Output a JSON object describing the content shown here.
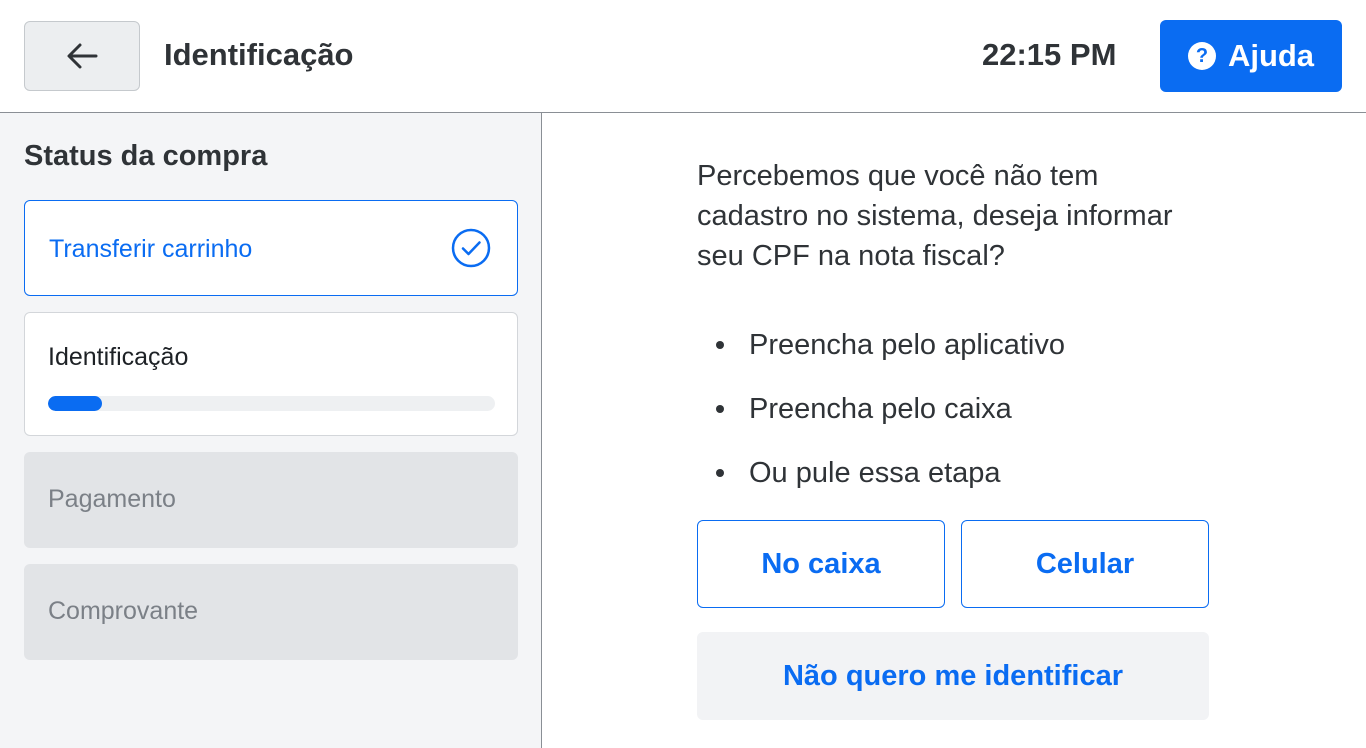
{
  "header": {
    "back_icon": "arrow-left-icon",
    "title": "Identificação",
    "time": "22:15 PM",
    "help_icon": "question-circle-icon",
    "help_label": "Ajuda",
    "accent_color": "#0a6cf2"
  },
  "sidebar": {
    "title": "Status da compra",
    "steps": [
      {
        "label": "Transferir carrinho",
        "state": "done",
        "icon": "check-circle-icon"
      },
      {
        "label": "Identificação",
        "state": "active",
        "progress": 0.12
      },
      {
        "label": "Pagamento",
        "state": "disabled"
      },
      {
        "label": "Comprovante",
        "state": "disabled"
      }
    ]
  },
  "main": {
    "question": "Percebemos que você não tem cadastro no sistema, deseja informar seu CPF na nota fiscal?",
    "options": [
      "Preencha pelo aplicativo",
      "Preencha pelo caixa",
      "Ou pule essa etapa"
    ],
    "buttons": {
      "caixa": "No caixa",
      "celular": "Celular",
      "skip": "Não quero me identificar"
    }
  }
}
